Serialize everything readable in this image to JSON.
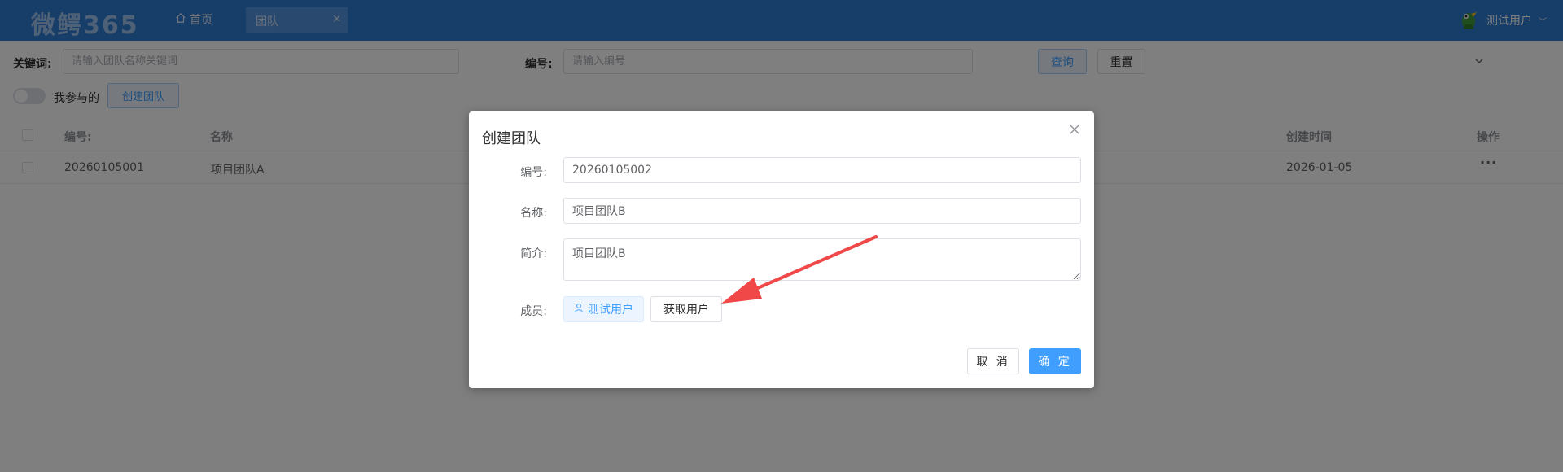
{
  "header": {
    "logo": "微鳄365",
    "home_label": "首页",
    "active_tab": "团队",
    "tab_close": "×",
    "user_name": "测试用户",
    "user_chevron": "﹀"
  },
  "search": {
    "keyword_label": "关键词:",
    "keyword_placeholder": "请输入团队名称关键词",
    "code_label": "编号:",
    "code_placeholder": "请输入编号",
    "query_label": "查询",
    "reset_label": "重置"
  },
  "toolbar": {
    "mine_label": "我参与的",
    "create_label": "创建团队"
  },
  "table": {
    "headers": {
      "code": "编号:",
      "name": "名称",
      "created": "创建时间",
      "actions": "操作"
    },
    "rows": [
      {
        "code": "20260105001",
        "name": "项目团队A",
        "created": "2026-01-05",
        "actions": "···"
      }
    ]
  },
  "dialog": {
    "title": "创建团队",
    "fields": {
      "code_label": "编号:",
      "code_value": "20260105002",
      "name_label": "名称:",
      "name_value": "项目团队B",
      "intro_label": "简介:",
      "intro_value": "项目团队B",
      "members_label": "成员:",
      "member_tag": "测试用户",
      "fetch_users_label": "获取用户"
    },
    "cancel_label": "取 消",
    "confirm_label": "确 定"
  },
  "colors": {
    "header_bg": "#2f7ad3",
    "primary": "#409eff",
    "annotation_arrow": "#f04848"
  }
}
